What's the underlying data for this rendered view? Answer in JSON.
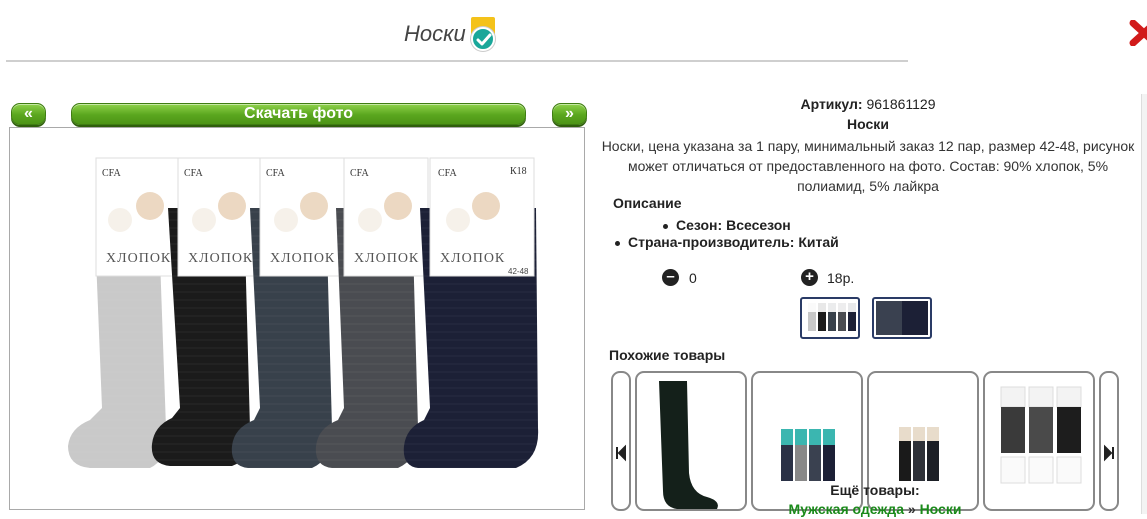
{
  "header": {
    "title": "Носки"
  },
  "gallery": {
    "prev_label": "«",
    "download_label": "Скачать фото",
    "next_label": "»"
  },
  "product": {
    "article_label": "Артикул:",
    "article_value": "961861129",
    "name": "Носки",
    "description": "Носки, цена указана за 1 пару, минимальный заказ 12 пар, размер 42-48, рисунок может отличаться от предоставленного на фото. Состав: 90% хлопок, 5% полиамид, 5% лайкра",
    "specs_heading": "Описание",
    "specs": [
      {
        "label": "Сезон:",
        "value": "Всесезон"
      },
      {
        "label": "Страна-производитель:",
        "value": "Китай"
      }
    ],
    "quantity": "0",
    "price": "18р."
  },
  "similar": {
    "heading": "Похожие товары"
  },
  "more": {
    "label": "Ещё товары:",
    "crumb1": "Мужская одежда",
    "separator": "»",
    "crumb2": "Носки"
  },
  "photo_label": {
    "brand": "CFA",
    "material": "ХЛОПОК",
    "code": "К18",
    "size": "42-48"
  },
  "colors": {
    "accent_green": "#5aa61e",
    "link_green": "#1a8a1a",
    "verify_teal": "#1aa79a",
    "verify_gold": "#f4c21a",
    "close_red": "#d11a1a"
  }
}
